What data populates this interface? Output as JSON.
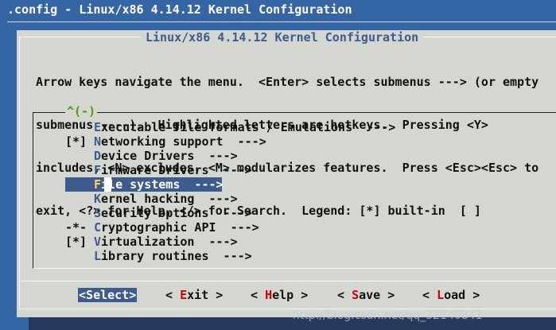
{
  "window": {
    "title": ".config - Linux/x86 4.14.12 Kernel Configuration"
  },
  "dialog": {
    "title": "Linux/x86 4.14.12 Kernel Configuration",
    "help_lines": [
      "Arrow keys navigate the menu.  <Enter> selects submenus ---> (or empty",
      "submenus ----).  Highlighted letters are hotkeys.  Pressing <Y>",
      "includes, <N> excludes, <M> modularizes features.  Press <Esc><Esc> to",
      "exit, <?> for Help, </> for Search.  Legend: [*] built-in  [ ]"
    ],
    "scroll_indicator": "^(-)",
    "menu_items": [
      {
        "mark": "   ",
        "hotkey": "E",
        "rest": "xecutable file formats / Emulations  --->"
      },
      {
        "mark": "[*]",
        "hotkey": "N",
        "rest": "etworking support  --->"
      },
      {
        "mark": "   ",
        "hotkey": "D",
        "rest": "evice Drivers  --->"
      },
      {
        "mark": "   ",
        "hotkey": "F",
        "rest": "irmware Drivers  --->"
      },
      {
        "mark": "   ",
        "hotkey": "F",
        "rest": "ile systems  --->",
        "selected": true
      },
      {
        "mark": "   ",
        "hotkey": "K",
        "rest": "ernel hacking  --->"
      },
      {
        "mark": "   ",
        "hotkey": "S",
        "rest": "ecurity options  --->"
      },
      {
        "mark": "-*-",
        "hotkey": "C",
        "rest": "ryptographic API  --->"
      },
      {
        "mark": "[*]",
        "hotkey": "V",
        "rest": "irtualization  --->"
      },
      {
        "mark": "   ",
        "hotkey": "L",
        "rest": "ibrary routines  --->"
      }
    ],
    "buttons": [
      {
        "pre": "<",
        "hotkey": "S",
        "rest": "elect>",
        "active": true
      },
      {
        "pre": "< ",
        "hotkey": "E",
        "rest": "xit >"
      },
      {
        "pre": "< ",
        "hotkey": "H",
        "rest": "elp >"
      },
      {
        "pre": "< ",
        "hotkey": "S",
        "rest": "ave >"
      },
      {
        "pre": "< ",
        "hotkey": "L",
        "rest": "oad >"
      }
    ]
  },
  "watermark": "http://blog.csdn.net/qq_32140841",
  "colors": {
    "terminal_bg": "#3465a4",
    "dialog_bg": "#d3d7cf",
    "selection_bg": "#3d5b8f",
    "hotkey_blue": "#3d5b8f",
    "button_hotkey_red": "#cc0000",
    "scroll_green": "#4e9a06"
  }
}
